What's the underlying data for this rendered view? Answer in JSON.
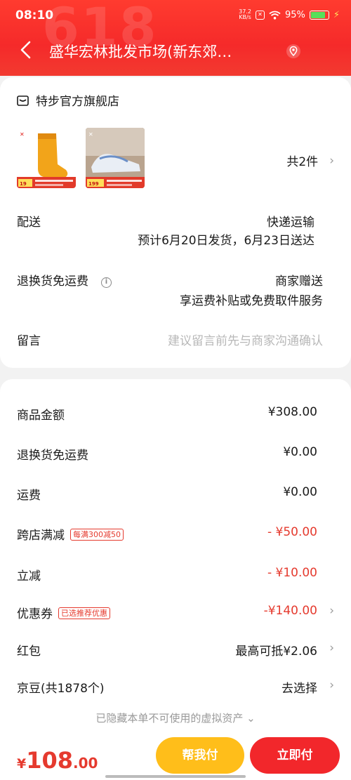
{
  "status_bar": {
    "time": "08:10",
    "net_speed": "37.2\nKB/s",
    "battery": "95%"
  },
  "header": {
    "title": "盛华宏林批发市场(新东郊…"
  },
  "order": {
    "shop_name": "特步官方旗舰店",
    "items_count": "共2件",
    "delivery": {
      "label": "配送",
      "method": "快递运输",
      "eta": "预计6月20日发货，6月23日送达"
    },
    "return_shipping": {
      "label": "退换货免运费",
      "value": "商家赠送",
      "desc": "享运费补贴或免费取件服务"
    },
    "note": {
      "label": "留言",
      "placeholder": "建议留言前先与商家沟通确认"
    }
  },
  "pricing": {
    "rows": [
      {
        "label": "商品金额",
        "value": "¥308.00"
      },
      {
        "label": "退换货免运费",
        "value": "¥0.00"
      },
      {
        "label": "运费",
        "value": "¥0.00"
      },
      {
        "label": "跨店满减",
        "tag": "每满300减50",
        "value": "- ¥50.00"
      },
      {
        "label": "立减",
        "value": "- ¥10.00"
      },
      {
        "label": "优惠券",
        "tag": "已选推荐优惠",
        "value": "-¥140.00"
      },
      {
        "label": "红包",
        "value": "最高可抵¥2.06"
      },
      {
        "label": "京豆(共1878个)",
        "value": "去选择"
      }
    ],
    "hidden_note": "已隐藏本单不可使用的虚拟资产 ⌄"
  },
  "bottom_bar": {
    "currency": "¥",
    "total_int": "108",
    "total_dec": ".00",
    "help_pay": "帮我付",
    "pay": "立即付"
  },
  "colors": {
    "header": "#f52a2a",
    "accent_red": "#e53a2e",
    "help_btn": "#ffbe1a",
    "pay_btn": "#f2272b"
  }
}
